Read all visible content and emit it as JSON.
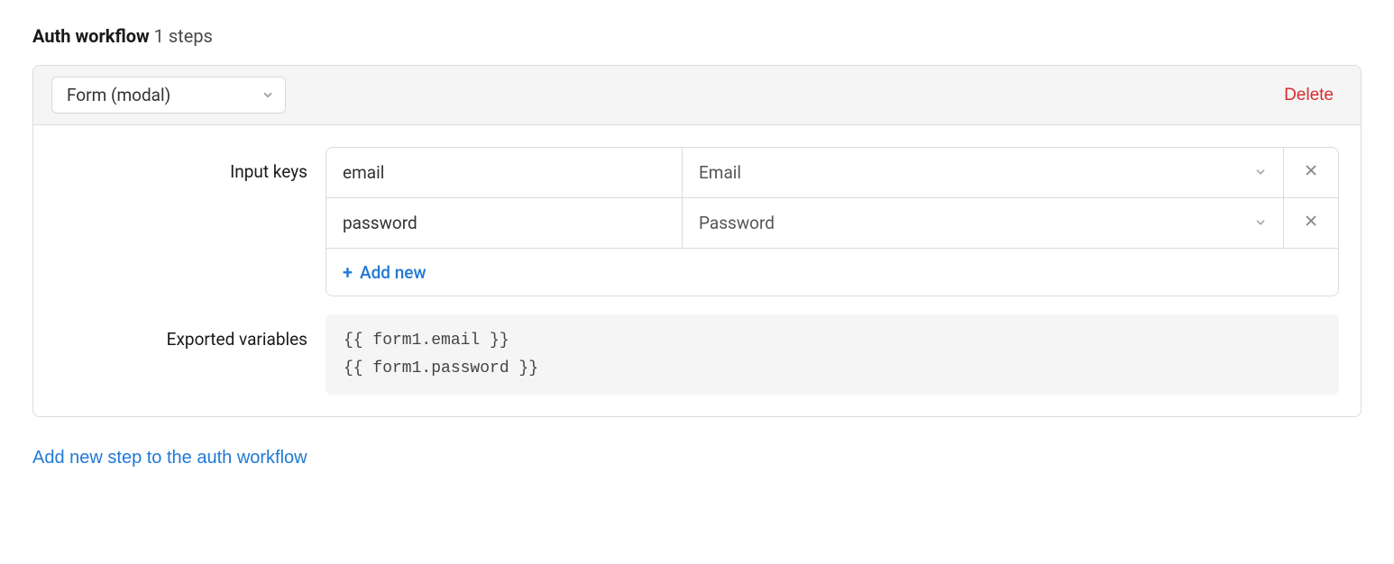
{
  "section": {
    "title_bold": "Auth workflow",
    "title_rest": "1 steps"
  },
  "step": {
    "type_label": "Form (modal)",
    "delete_label": "Delete",
    "input_keys_label": "Input keys",
    "input_keys": [
      {
        "key": "email",
        "type": "Email"
      },
      {
        "key": "password",
        "type": "Password"
      }
    ],
    "add_new_label": "Add new",
    "exported_label": "Exported variables",
    "exported_code": "{{ form1.email }}\n{{ form1.password }}"
  },
  "add_step_label": "Add new step to the auth workflow"
}
